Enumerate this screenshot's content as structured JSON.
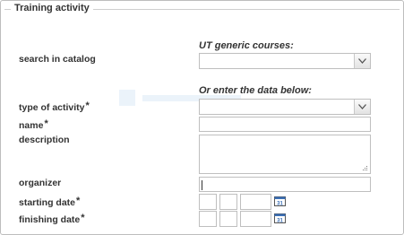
{
  "section": {
    "title": "Training activity"
  },
  "catalog": {
    "hint": "UT generic courses:",
    "label": "search in catalog",
    "selected": ""
  },
  "manual": {
    "hint": "Or enter the data below:"
  },
  "fields": {
    "type_label": "type of activity",
    "name_label": "name",
    "description_label": "description",
    "organizer_label": "organizer",
    "starting_date_label": "starting date",
    "finishing_date_label": "finishing date",
    "required_mark": "*",
    "type_value": "",
    "name_value": "",
    "description_value": "",
    "organizer_value": ""
  },
  "calendar_icon_text": "31",
  "colors": {
    "border": "#bfbfbf",
    "label": "#333333",
    "calendar_blue": "#3b6fb5"
  },
  "icons": {
    "dropdown": "chevron-down-icon",
    "calendar": "calendar-icon",
    "resize": "resize-grip-icon"
  }
}
